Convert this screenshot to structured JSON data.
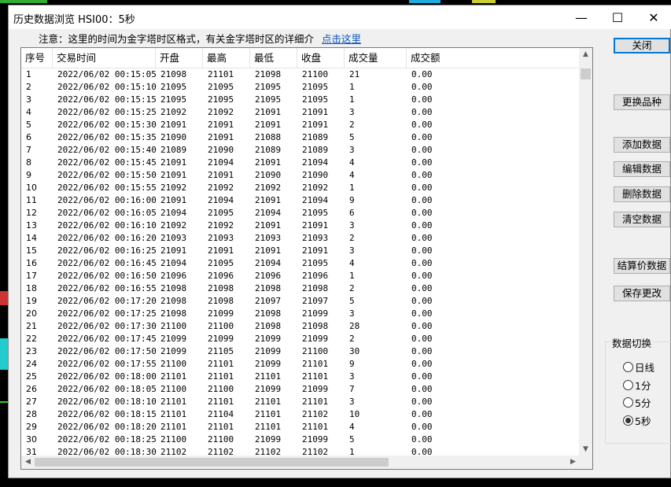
{
  "window": {
    "title": "历史数据浏览 HSI00：5秒",
    "minimize_glyph": "—",
    "maximize_glyph": "☐",
    "close_glyph": "✕"
  },
  "notice": {
    "text": "注意：这里的时间为金字塔时区格式，有关金字塔时区的详细介",
    "link": "点击这里"
  },
  "table": {
    "columns": [
      "序号",
      "交易时间",
      "开盘",
      "最高",
      "最低",
      "收盘",
      "成交量",
      "成交额"
    ],
    "rows": [
      [
        "1",
        "2022/06/02  00:15:05",
        "21098",
        "21101",
        "21098",
        "21100",
        "21",
        "0.00"
      ],
      [
        "2",
        "2022/06/02  00:15:10",
        "21095",
        "21095",
        "21095",
        "21095",
        "1",
        "0.00"
      ],
      [
        "3",
        "2022/06/02  00:15:15",
        "21095",
        "21095",
        "21095",
        "21095",
        "1",
        "0.00"
      ],
      [
        "4",
        "2022/06/02  00:15:25",
        "21092",
        "21092",
        "21091",
        "21091",
        "3",
        "0.00"
      ],
      [
        "5",
        "2022/06/02  00:15:30",
        "21091",
        "21091",
        "21091",
        "21091",
        "2",
        "0.00"
      ],
      [
        "6",
        "2022/06/02  00:15:35",
        "21090",
        "21091",
        "21088",
        "21089",
        "5",
        "0.00"
      ],
      [
        "7",
        "2022/06/02  00:15:40",
        "21089",
        "21090",
        "21089",
        "21089",
        "3",
        "0.00"
      ],
      [
        "8",
        "2022/06/02  00:15:45",
        "21091",
        "21094",
        "21091",
        "21094",
        "4",
        "0.00"
      ],
      [
        "9",
        "2022/06/02  00:15:50",
        "21091",
        "21091",
        "21090",
        "21090",
        "4",
        "0.00"
      ],
      [
        "10",
        "2022/06/02  00:15:55",
        "21092",
        "21092",
        "21092",
        "21092",
        "1",
        "0.00"
      ],
      [
        "11",
        "2022/06/02  00:16:00",
        "21091",
        "21094",
        "21091",
        "21094",
        "9",
        "0.00"
      ],
      [
        "12",
        "2022/06/02  00:16:05",
        "21094",
        "21095",
        "21094",
        "21095",
        "6",
        "0.00"
      ],
      [
        "13",
        "2022/06/02  00:16:10",
        "21092",
        "21092",
        "21091",
        "21091",
        "3",
        "0.00"
      ],
      [
        "14",
        "2022/06/02  00:16:20",
        "21093",
        "21093",
        "21093",
        "21093",
        "2",
        "0.00"
      ],
      [
        "15",
        "2022/06/02  00:16:25",
        "21091",
        "21091",
        "21091",
        "21091",
        "3",
        "0.00"
      ],
      [
        "16",
        "2022/06/02  00:16:45",
        "21094",
        "21095",
        "21094",
        "21095",
        "4",
        "0.00"
      ],
      [
        "17",
        "2022/06/02  00:16:50",
        "21096",
        "21096",
        "21096",
        "21096",
        "1",
        "0.00"
      ],
      [
        "18",
        "2022/06/02  00:16:55",
        "21098",
        "21098",
        "21098",
        "21098",
        "2",
        "0.00"
      ],
      [
        "19",
        "2022/06/02  00:17:20",
        "21098",
        "21098",
        "21097",
        "21097",
        "5",
        "0.00"
      ],
      [
        "20",
        "2022/06/02  00:17:25",
        "21098",
        "21099",
        "21098",
        "21099",
        "3",
        "0.00"
      ],
      [
        "21",
        "2022/06/02  00:17:30",
        "21100",
        "21100",
        "21098",
        "21098",
        "28",
        "0.00"
      ],
      [
        "22",
        "2022/06/02  00:17:45",
        "21099",
        "21099",
        "21099",
        "21099",
        "2",
        "0.00"
      ],
      [
        "23",
        "2022/06/02  00:17:50",
        "21099",
        "21105",
        "21099",
        "21100",
        "30",
        "0.00"
      ],
      [
        "24",
        "2022/06/02  00:17:55",
        "21100",
        "21101",
        "21099",
        "21101",
        "9",
        "0.00"
      ],
      [
        "25",
        "2022/06/02  00:18:00",
        "21101",
        "21101",
        "21101",
        "21101",
        "3",
        "0.00"
      ],
      [
        "26",
        "2022/06/02  00:18:05",
        "21100",
        "21100",
        "21099",
        "21099",
        "7",
        "0.00"
      ],
      [
        "27",
        "2022/06/02  00:18:10",
        "21101",
        "21101",
        "21101",
        "21101",
        "3",
        "0.00"
      ],
      [
        "28",
        "2022/06/02  00:18:15",
        "21101",
        "21104",
        "21101",
        "21102",
        "10",
        "0.00"
      ],
      [
        "29",
        "2022/06/02  00:18:20",
        "21101",
        "21101",
        "21101",
        "21101",
        "4",
        "0.00"
      ],
      [
        "30",
        "2022/06/02  00:18:25",
        "21100",
        "21100",
        "21099",
        "21099",
        "5",
        "0.00"
      ],
      [
        "31",
        "2022/06/02  00:18:30",
        "21102",
        "21102",
        "21102",
        "21102",
        "1",
        "0.00"
      ]
    ]
  },
  "buttons": {
    "close": "关闭",
    "change_symbol": "更换品种",
    "add_data": "添加数据",
    "edit_data": "编辑数据",
    "delete_data": "删除数据",
    "clear_data": "清空数据",
    "settlement": "结算价数据",
    "save": "保存更改"
  },
  "data_switch": {
    "label": "数据切换",
    "options": [
      "日线",
      "1分",
      "5分",
      "5秒"
    ],
    "selected": "5秒"
  },
  "colors": {
    "accent": "#0078d7",
    "link": "#0a57c2"
  }
}
